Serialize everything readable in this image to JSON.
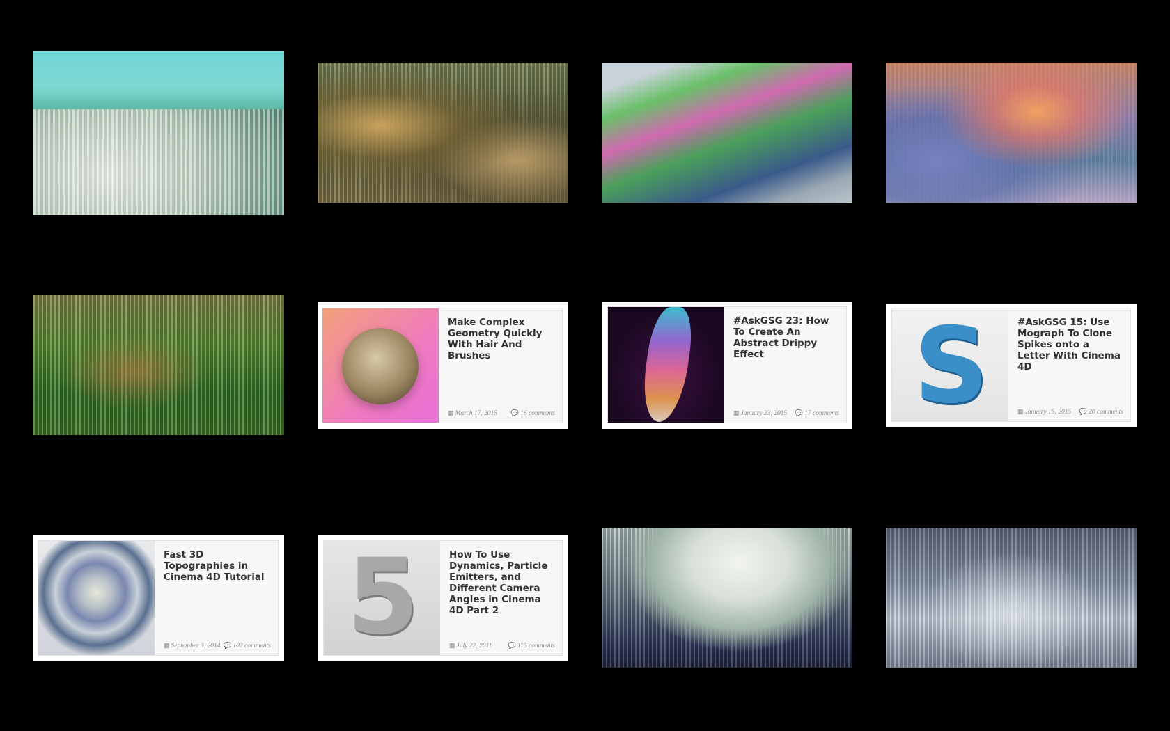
{
  "gallery": {
    "image_tiles": [
      {
        "icon": "landscape-image",
        "alt": ""
      },
      {
        "icon": "landscape-image",
        "alt": ""
      },
      {
        "icon": "landscape-image",
        "alt": ""
      },
      {
        "icon": "landscape-image",
        "alt": ""
      },
      {
        "icon": "landscape-image",
        "alt": ""
      },
      {
        "icon": "landscape-image",
        "alt": ""
      },
      {
        "icon": "landscape-image",
        "alt": ""
      }
    ],
    "cards": [
      {
        "title": "Make Complex Geometry Quickly With Hair And Brushes",
        "date": "March 17, 2015",
        "comments": "16 comments"
      },
      {
        "title": "#AskGSG 23: How To Create An Abstract Drippy Effect",
        "date": "January 23, 2015",
        "comments": "17 comments"
      },
      {
        "title": "#AskGSG 15: Use Mograph To Clone Spikes onto a Letter With Cinema 4D",
        "date": "January 15, 2015",
        "comments": "20 comments"
      },
      {
        "title": "Fast 3D Topographies in Cinema 4D Tutorial",
        "date": "September 3, 2014",
        "comments": "102 comments"
      },
      {
        "title": "How To Use Dynamics, Particle Emitters, and Different Camera Angles in Cinema 4D Part 2",
        "date": "July 22, 2011",
        "comments": "115 comments"
      }
    ]
  },
  "colors": {
    "background": "#000000",
    "card_bg": "#f7f7f8",
    "title_text": "#333333",
    "meta_text": "#8a8a8a"
  }
}
